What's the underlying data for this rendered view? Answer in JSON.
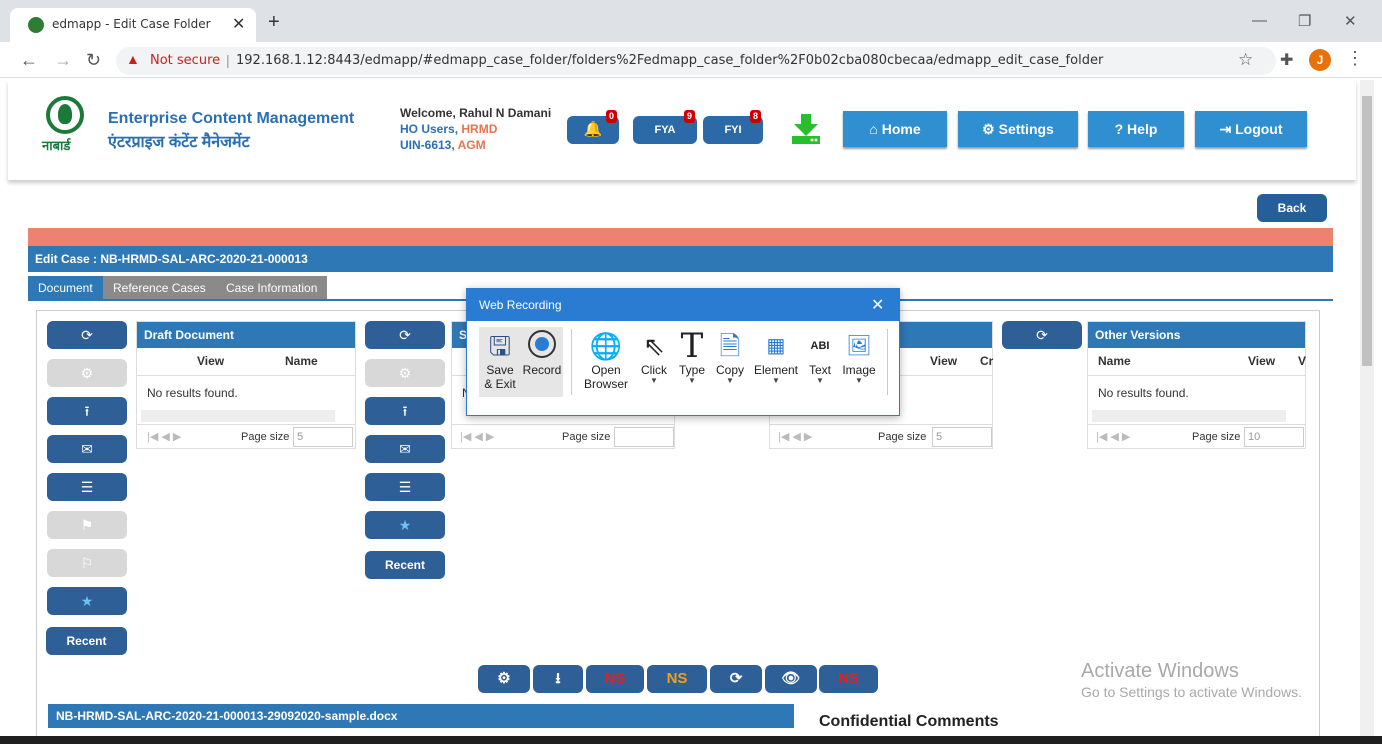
{
  "browser": {
    "tab_title": "edmapp - Edit Case Folder",
    "new_tab": "+",
    "not_secure": "Not secure",
    "url": "192.168.1.12:8443/edmapp/#edmapp_case_folder/folders%2Fedmapp_case_folder%2F0b02cba080cbecaa/edmapp_edit_case_folder",
    "avatar": "J"
  },
  "header": {
    "logo_text": "नाबार्ड",
    "brand_en": "Enterprise Content Management",
    "brand_hi": "एंटरप्राइज कंटेंट मैनेजमेंट",
    "welcome": "Welcome, Rahul N Damani",
    "dept_a": "HO Users, ",
    "dept_b": "HRMD",
    "uin_a": "UIN-6613, ",
    "uin_b": "AGM",
    "notif_count": "0",
    "fya": "FYA",
    "fya_count": "9",
    "fyi": "FYI",
    "fyi_count": "8",
    "home": "Home",
    "settings": "Settings",
    "help": "Help",
    "logout": "Logout"
  },
  "back": "Back",
  "case_title": "Edit Case : NB-HRMD-SAL-ARC-2020-21-000013",
  "tabs": [
    "Document",
    "Reference Cases",
    "Case Information"
  ],
  "panels": {
    "draft": {
      "title": "Draft Document",
      "col1": "View",
      "col2": "Name",
      "empty": "No results found.",
      "page_size": "Page size",
      "size_val": "5"
    },
    "second": {
      "title": "S",
      "empty": "N",
      "page_size": "Page size",
      "size_val": ""
    },
    "third": {
      "col1": "View",
      "col2": "Cr",
      "page_size": "Page size",
      "size_val": "5"
    },
    "other": {
      "title": "Other Versions",
      "col1": "Name",
      "col2": "View",
      "col3": "V",
      "empty": "No results found.",
      "page_size": "Page size",
      "size_val": "10"
    }
  },
  "recent": "Recent",
  "bottom_ns": "NS",
  "file_name": "NB-HRMD-SAL-ARC-2020-21-000013-29092020-sample.docx",
  "confidential": "Confidential Comments",
  "activate": {
    "line1": "Activate Windows",
    "line2": "Go to Settings to activate Windows."
  },
  "recording": {
    "title": "Web Recording",
    "save": "Save",
    "exit": "& Exit",
    "record": "Record",
    "open": "Open",
    "browser": "Browser",
    "click": "Click",
    "type": "Type",
    "copy": "Copy",
    "element": "Element",
    "text": "Text",
    "image": "Image"
  }
}
